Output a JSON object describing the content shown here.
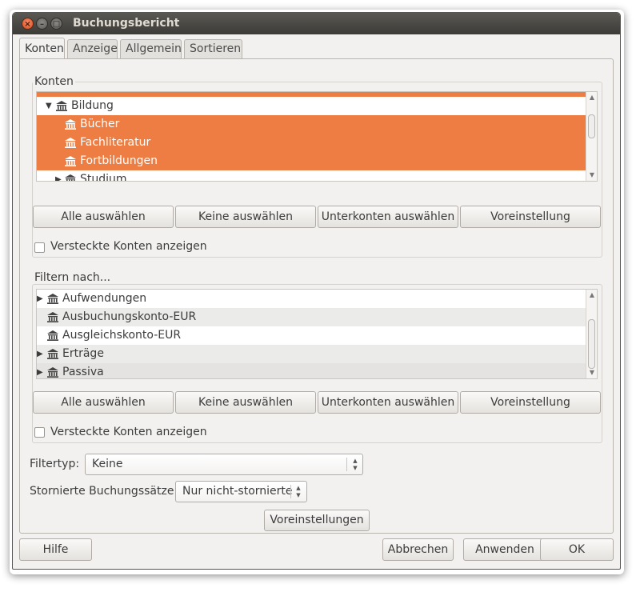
{
  "window": {
    "title": "Buchungsbericht"
  },
  "tabs": [
    "Konten",
    "Anzeige",
    "Allgemein",
    "Sortieren"
  ],
  "konten": {
    "frame_label": "Konten",
    "rows": [
      {
        "label": "",
        "selected": true,
        "expander": "",
        "has_icon": false
      },
      {
        "label": "Bildung",
        "selected": false,
        "expander": "▼",
        "has_icon": true
      },
      {
        "label": "Bücher",
        "selected": true,
        "expander": "",
        "has_icon": true
      },
      {
        "label": "Fachliteratur",
        "selected": true,
        "expander": "",
        "has_icon": true
      },
      {
        "label": "Fortbildungen",
        "selected": true,
        "expander": "",
        "has_icon": true
      },
      {
        "label": "Studium",
        "selected": false,
        "expander": "▶",
        "has_icon": true
      }
    ],
    "buttons": [
      "Alle auswählen",
      "Keine auswählen",
      "Unterkonten auswählen",
      "Voreinstellung"
    ],
    "checkbox_label": "Versteckte Konten anzeigen"
  },
  "filter": {
    "frame_label": "Filtern nach...",
    "rows": [
      {
        "label": "Aufwendungen",
        "expander": "▶",
        "alt": false
      },
      {
        "label": "Ausbuchungskonto-EUR",
        "expander": "",
        "alt": true
      },
      {
        "label": "Ausgleichskonto-EUR",
        "expander": "",
        "alt": false
      },
      {
        "label": "Erträge",
        "expander": "▶",
        "alt": true
      },
      {
        "label": "Passiva",
        "expander": "▶",
        "alt": false
      }
    ],
    "buttons": [
      "Alle auswählen",
      "Keine auswählen",
      "Unterkonten auswählen",
      "Voreinstellung"
    ],
    "checkbox_label": "Versteckte Konten anzeigen"
  },
  "filtertyp": {
    "label": "Filtertyp:",
    "value": "Keine"
  },
  "storniert": {
    "label": "Stornierte Buchungssätze:",
    "value": "Nur nicht-stornierte"
  },
  "defaults_button": "Voreinstellungen",
  "footer": {
    "help": "Hilfe",
    "cancel": "Abbrechen",
    "apply": "Anwenden",
    "ok": "OK"
  },
  "colors": {
    "selection": "#ee7d44",
    "close_button": "#df4a16",
    "titlebar": "#3c3b37"
  },
  "icons": {
    "account": "bank-building-icon"
  }
}
